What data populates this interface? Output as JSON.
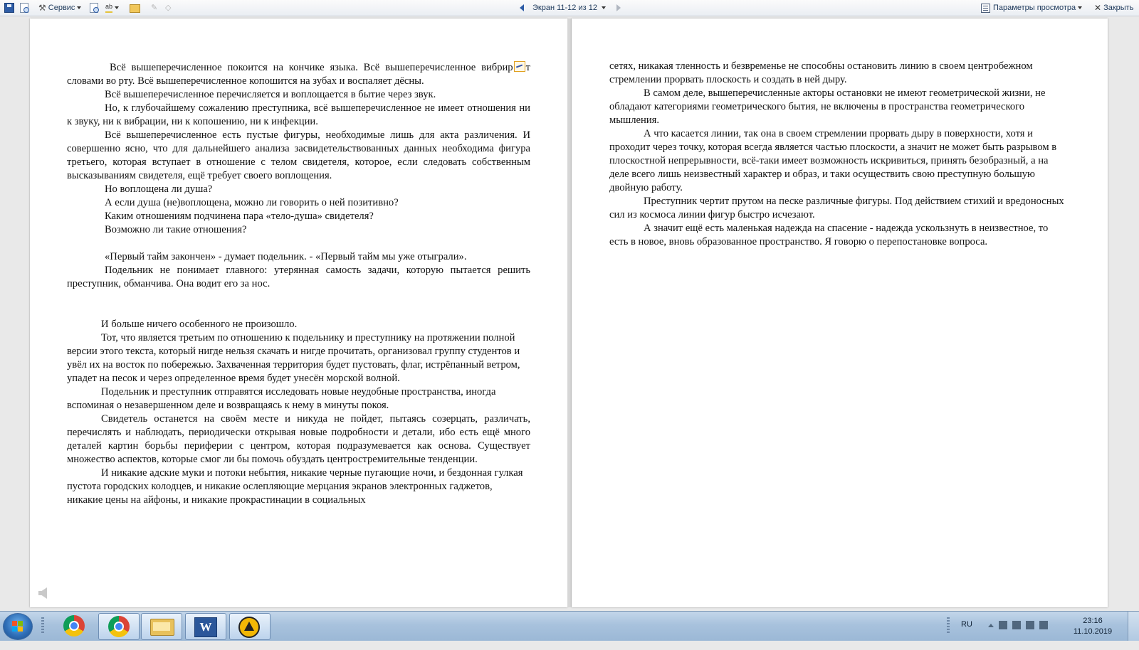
{
  "toolbar": {
    "service_label": "Сервис",
    "screen_label": "Экран 11-12 из 12",
    "view_params_label": "Параметры просмотра",
    "close_label": "Закрыть"
  },
  "left_page": {
    "paragraphs": [
      "Всё вышеперечисленное покоится на кончике языка. Всё вышеперечисленное вибрир",
      "т словами во рту. Всё вышеперечисленное копошится на зубах и воспаляет дёсны.",
      "Всё вышеперечисленное перечисляется и воплощается в бытие через звук.",
      "Но, к глубочайшему сожалению преступника, всё вышеперечисленное не имеет отношения ни к звуку, ни к вибрации, ни к копошению, ни к инфекции.",
      "Всё вышеперечисленное есть пустые фигуры, необходимые лишь для акта различения. И совершенно ясно, что для дальнейшего анализа засвидетельствованных данных необходима фигура третьего, которая вступает в отношение с телом свидетеля, которое, если следовать собственным высказываниям свидетеля, ещё требует своего воплощения.",
      "Но воплощена ли душа?",
      "А если душа (не)воплощена, можно ли говорить о ней позитивно?",
      "Каким отношениям подчинена пара «тело-душа» свидетеля?",
      "Возможно ли такие отношения?",
      "«Первый тайм закончен» - думает подельник. - «Первый тайм мы уже отыграли».",
      "Подельник не понимает главного: утерянная самость задачи, которую пытается решить преступник, обманчива. Она водит его за нос.",
      "И больше ничего особенного не произошло.",
      "Тот, что является третьим по отношению к подельнику и преступнику на протяжении полной версии этого текста, который нигде нельзя скачать и нигде прочитать, организовал группу студентов и увёл их на восток по побережью. Захваченная территория будет пустовать, флаг, истрёпанный ветром, упадет на песок и через определенное время будет унесён морской волной.",
      "Подельник и преступник отправятся исследовать новые неудобные пространства, иногда вспоминая о незавершенном деле и возвращаясь к нему в минуты покоя.",
      "Свидетель останется на своём месте и никуда не пойдет, пытаясь созерцать, различать, перечислять и наблюдать, периодически открывая новые подробности и детали, ибо есть ещё много деталей картин борьбы периферии с центром, которая подразумевается как основа. Существует множество аспектов, которые смог ли бы помочь обуздать центростремительные тенденции.",
      "И никакие адские муки и потоки небытия, никакие черные пугающие ночи, и бездонная гулкая пустота городских колодцев, и никакие ослепляющие мерцания экранов электронных гаджетов, никакие цены на айфоны, и никакие прокрастинации в  социальных"
    ]
  },
  "right_page": {
    "paragraphs": [
      "сетях, никакая тленность и безвременье не способны остановить линию в своем центробежном стремлении прорвать плоскость и создать в ней дыру.",
      "В самом деле, вышеперечисленные акторы остановки не имеют геометрической жизни, не обладают категориями геометрического бытия, не включены в пространства геометрического мышления.",
      "А что касается линии, так она в своем стремлении прорвать дыру в поверхности, хотя и проходит через точку, которая всегда является частью плоскости, а значит не может быть разрывом в плоскостной непрерывности, всё-таки имеет возможность искривиться, принять безобразный, а на деле всего лишь неизвестный характер и образ, и таки осуществить свою преступную большую двойную работу.",
      "Преступник чертит прутом на песке различные фигуры. Под действием стихий и вредоносных сил из космоса линии фигур быстро исчезают.",
      "А значит ещё есть маленькая надежда на спасение - надежда ускользнуть в неизвестное, то есть в новое, вновь образованное пространство. Я говорю о перепостановке вопроса."
    ]
  },
  "taskbar": {
    "language": "RU",
    "time": "23:16",
    "date": "11.10.2019",
    "apps": [
      "chrome-icon",
      "chrome-icon",
      "explorer-icon",
      "word-icon",
      "aimp-icon"
    ]
  },
  "colors": {
    "toolbar_text": "#1e395b",
    "taskbar": "#a8c2dd",
    "page": "#ffffff",
    "accent": "#2b579a"
  }
}
